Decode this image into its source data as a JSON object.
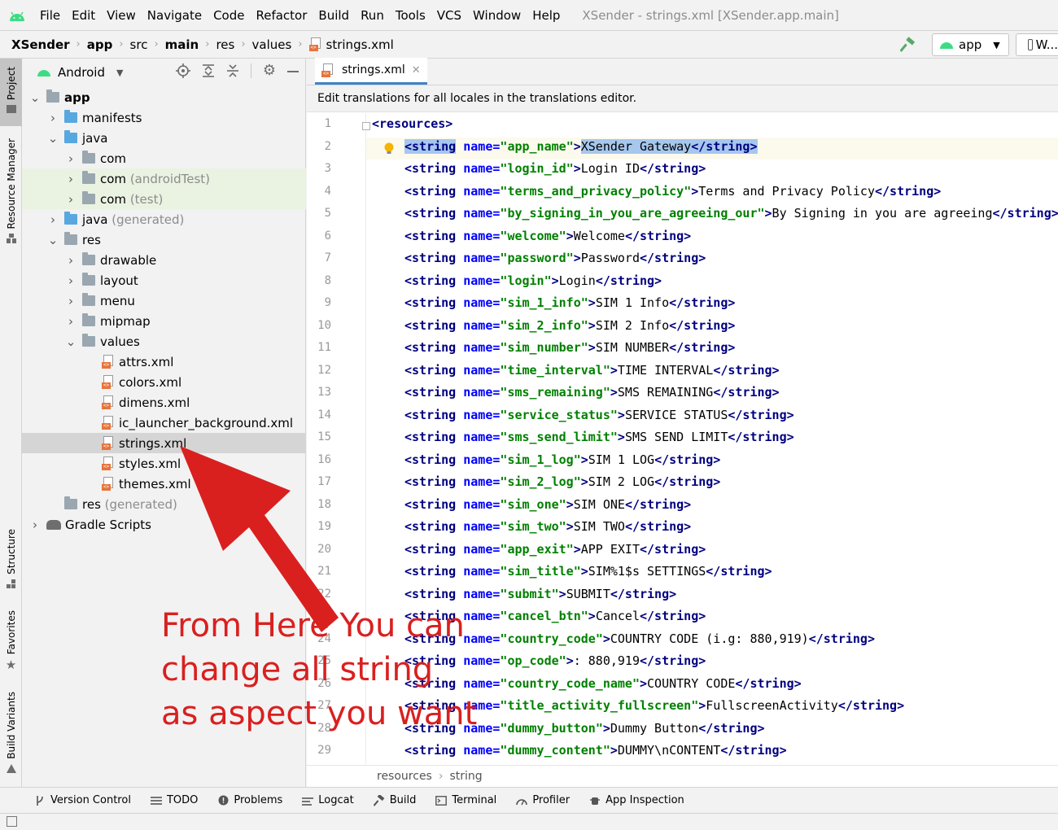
{
  "menubar": {
    "items": [
      "File",
      "Edit",
      "View",
      "Navigate",
      "Code",
      "Refactor",
      "Build",
      "Run",
      "Tools",
      "VCS",
      "Window",
      "Help"
    ],
    "window_title": "XSender - strings.xml [XSender.app.main]"
  },
  "navbar": {
    "crumbs": [
      "XSender",
      "app",
      "src",
      "main",
      "res",
      "values",
      "strings.xml"
    ],
    "run_config": "app",
    "device": "W..."
  },
  "left_strip": {
    "tabs": [
      "Project",
      "Resource Manager",
      "Structure",
      "Favorites",
      "Build Variants"
    ]
  },
  "project": {
    "view_mode": "Android",
    "tree": [
      {
        "label": "app",
        "extra": ""
      },
      {
        "label": "manifests",
        "extra": ""
      },
      {
        "label": "java",
        "extra": ""
      },
      {
        "label": "com",
        "extra": ""
      },
      {
        "label": "com",
        "extra": "(androidTest)"
      },
      {
        "label": "com",
        "extra": "(test)"
      },
      {
        "label": "java",
        "extra": "(generated)"
      },
      {
        "label": "res",
        "extra": ""
      },
      {
        "label": "drawable",
        "extra": ""
      },
      {
        "label": "layout",
        "extra": ""
      },
      {
        "label": "menu",
        "extra": ""
      },
      {
        "label": "mipmap",
        "extra": ""
      },
      {
        "label": "values",
        "extra": ""
      },
      {
        "label": "attrs.xml",
        "extra": ""
      },
      {
        "label": "colors.xml",
        "extra": ""
      },
      {
        "label": "dimens.xml",
        "extra": ""
      },
      {
        "label": "ic_launcher_background.xml",
        "extra": ""
      },
      {
        "label": "strings.xml",
        "extra": ""
      },
      {
        "label": "styles.xml",
        "extra": ""
      },
      {
        "label": "themes.xml",
        "extra": ""
      },
      {
        "label": "res",
        "extra": "(generated)"
      },
      {
        "label": "Gradle Scripts",
        "extra": ""
      }
    ]
  },
  "editor": {
    "tab": "strings.xml",
    "banner": "Edit translations for all locales in the translations editor.",
    "root_open": "<resources>",
    "lines": [
      {
        "name": "app_name",
        "value": "XSender Gateway"
      },
      {
        "name": "login_id",
        "value": "Login ID"
      },
      {
        "name": "terms_and_privacy_policy",
        "value": "Terms and Privacy Policy"
      },
      {
        "name": "by_signing_in_you_are_agreeing_our",
        "value": "By Signing in you are agreeing"
      },
      {
        "name": "welcome",
        "value": "Welcome"
      },
      {
        "name": "password",
        "value": "Password"
      },
      {
        "name": "login",
        "value": "Login"
      },
      {
        "name": "sim_1_info",
        "value": "SIM 1 Info"
      },
      {
        "name": "sim_2_info",
        "value": "SIM 2 Info"
      },
      {
        "name": "sim_number",
        "value": "SIM NUMBER"
      },
      {
        "name": "time_interval",
        "value": "TIME INTERVAL"
      },
      {
        "name": "sms_remaining",
        "value": "SMS REMAINING"
      },
      {
        "name": "service_status",
        "value": "SERVICE STATUS"
      },
      {
        "name": "sms_send_limit",
        "value": "SMS SEND LIMIT"
      },
      {
        "name": "sim_1_log",
        "value": "SIM 1 LOG"
      },
      {
        "name": "sim_2_log",
        "value": "SIM 2 LOG"
      },
      {
        "name": "sim_one",
        "value": "SIM ONE"
      },
      {
        "name": "sim_two",
        "value": "SIM TWO"
      },
      {
        "name": "app_exit",
        "value": "APP EXIT"
      },
      {
        "name": "sim_title",
        "value": "SIM%1$s SETTINGS"
      },
      {
        "name": "submit",
        "value": "SUBMIT"
      },
      {
        "name": "cancel_btn",
        "value": "Cancel"
      },
      {
        "name": "country_code",
        "value": "COUNTRY CODE (i.g: 880,919)"
      },
      {
        "name": "op_code",
        "value": ": 880,919"
      },
      {
        "name": "country_code_name",
        "value": "COUNTRY CODE"
      },
      {
        "name": "title_activity_fullscreen",
        "value": "FullscreenActivity"
      },
      {
        "name": "dummy_button",
        "value": "Dummy Button"
      },
      {
        "name": "dummy_content",
        "value": "DUMMY\\nCONTENT"
      }
    ],
    "breadcrumb": [
      "resources",
      "string"
    ]
  },
  "bottombar": {
    "items": [
      "Version Control",
      "TODO",
      "Problems",
      "Logcat",
      "Build",
      "Terminal",
      "Profiler",
      "App Inspection"
    ]
  },
  "annotation": {
    "lines": [
      "From Here You can",
      "change all string",
      "as aspect you want"
    ],
    "color": "#d9201f"
  }
}
